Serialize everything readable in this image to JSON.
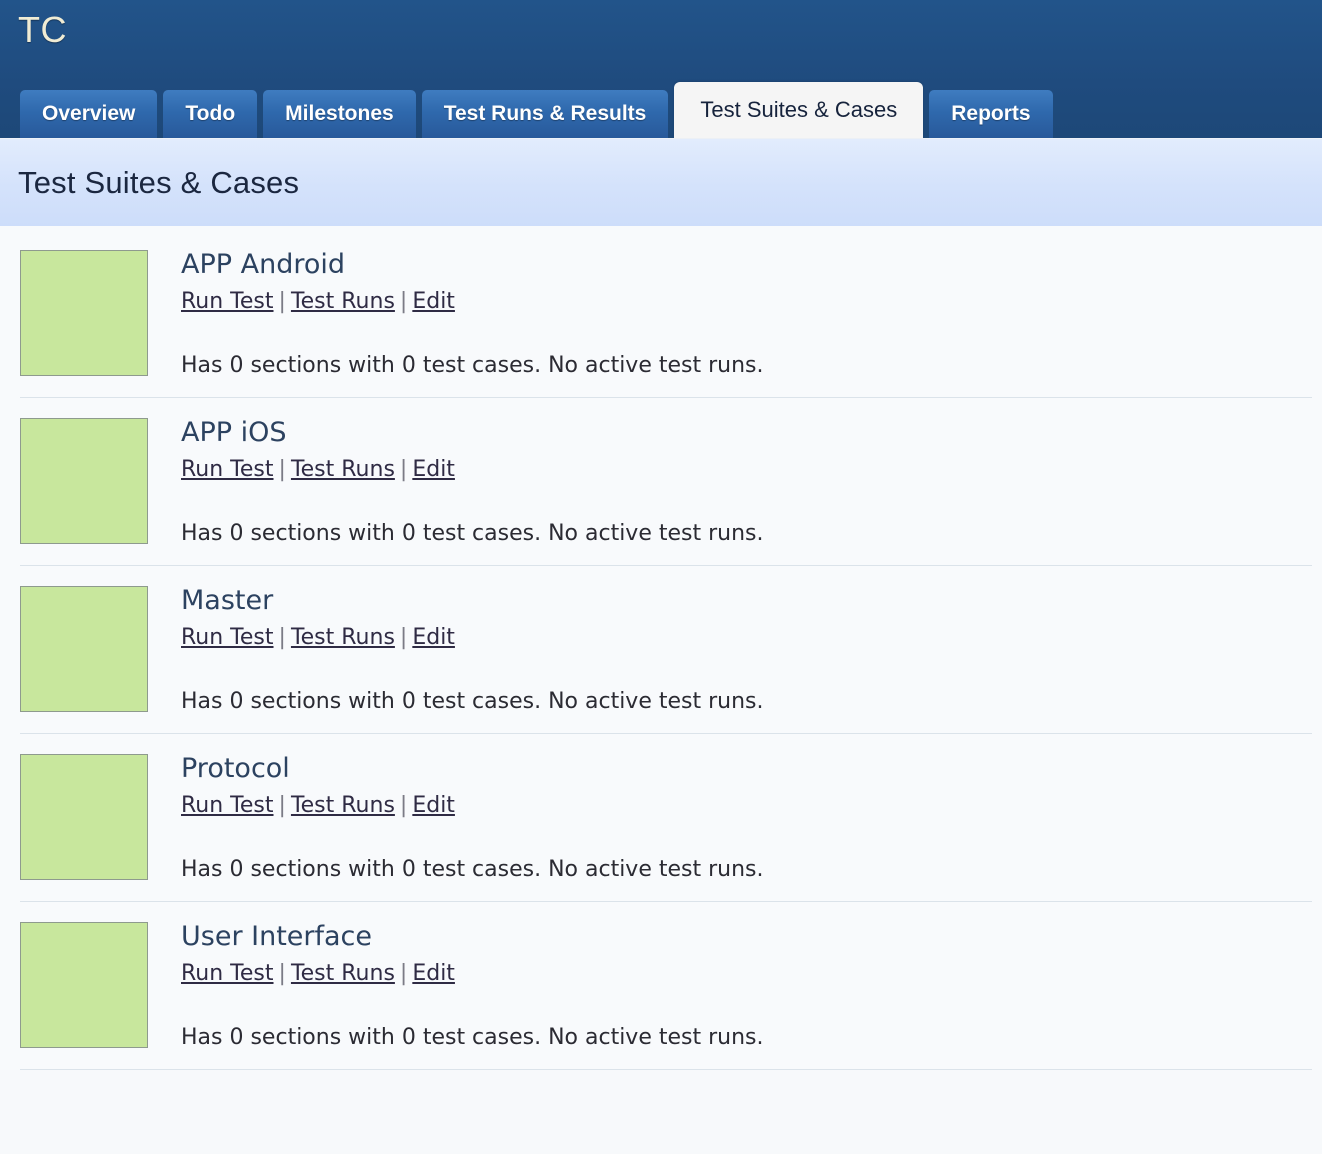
{
  "header": {
    "brand": "TC",
    "brand_color": "#f0ecd4",
    "background_color": "#1f4b7e"
  },
  "tabs": [
    {
      "label": "Overview",
      "active": false
    },
    {
      "label": "Todo",
      "active": false
    },
    {
      "label": "Milestones",
      "active": false
    },
    {
      "label": "Test Runs & Results",
      "active": false
    },
    {
      "label": "Test Suites & Cases",
      "active": true
    },
    {
      "label": "Reports",
      "active": false
    }
  ],
  "page": {
    "title": "Test Suites & Cases",
    "title_band_color": "#d4e2fb"
  },
  "links": {
    "run_test": "Run Test",
    "test_runs": "Test Runs",
    "edit": "Edit",
    "separator": "|"
  },
  "suites": [
    {
      "name": "APP Android",
      "thumb_color": "#c8e79d",
      "meta": "Has 0 sections with 0 test cases. No active test runs."
    },
    {
      "name": "APP iOS",
      "thumb_color": "#c8e79d",
      "meta": "Has 0 sections with 0 test cases. No active test runs."
    },
    {
      "name": "Master",
      "thumb_color": "#c8e79d",
      "meta": "Has 0 sections with 0 test cases. No active test runs."
    },
    {
      "name": "Protocol",
      "thumb_color": "#c8e79d",
      "meta": "Has 0 sections with 0 test cases. No active test runs."
    },
    {
      "name": "User Interface",
      "thumb_color": "#c8e79d",
      "meta": "Has 0 sections with 0 test cases. No active test runs."
    }
  ]
}
